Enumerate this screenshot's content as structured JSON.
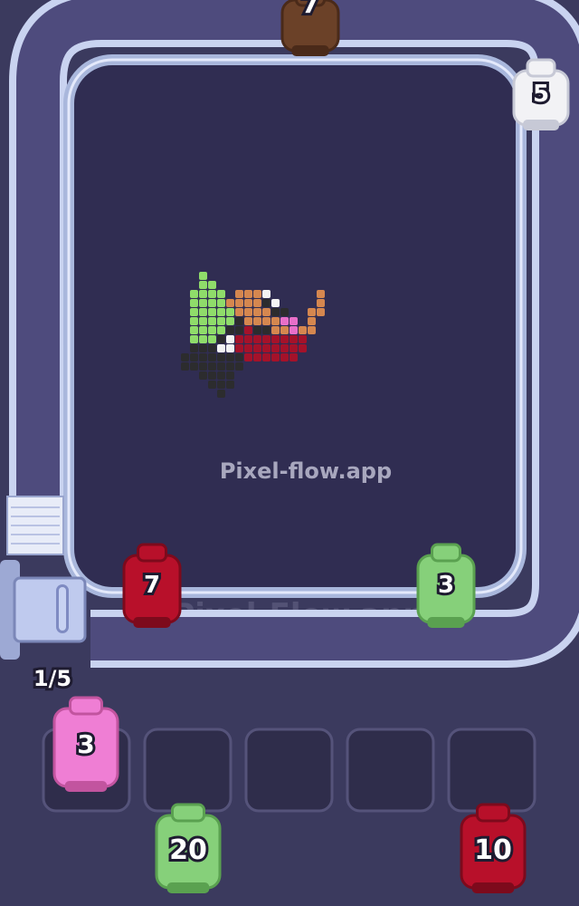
{
  "watermark": "Pixel-flow.app",
  "belt_watermark": "Pixel-Flow.app",
  "queue_counter": "1/5",
  "colors": {
    "background": "#3b3a5e",
    "board": "#302d52",
    "belt": "#a9b7dc",
    "brown": "#6b4128",
    "white": "#f2f2f5",
    "red": "#b8102a",
    "green": "#86d07a",
    "pink": "#ef7ed4"
  },
  "belt_shooters": [
    {
      "id": "brown",
      "label": "7",
      "color": "brown"
    },
    {
      "id": "white",
      "label": "5",
      "color": "white"
    },
    {
      "id": "red",
      "label": "7",
      "color": "red"
    },
    {
      "id": "green",
      "label": "3",
      "color": "green"
    }
  ],
  "active_shooter": {
    "id": "pink",
    "label": "3",
    "color": "pink"
  },
  "slots": [
    {
      "id": "slot-1",
      "filled": true
    },
    {
      "id": "slot-2",
      "filled": false
    },
    {
      "id": "slot-3",
      "filled": false
    },
    {
      "id": "slot-4",
      "filled": false
    },
    {
      "id": "slot-5",
      "filled": false
    }
  ],
  "bottom_queue": [
    {
      "id": "green",
      "label": "20",
      "color": "green"
    },
    {
      "id": "red",
      "label": "10",
      "color": "red"
    }
  ]
}
